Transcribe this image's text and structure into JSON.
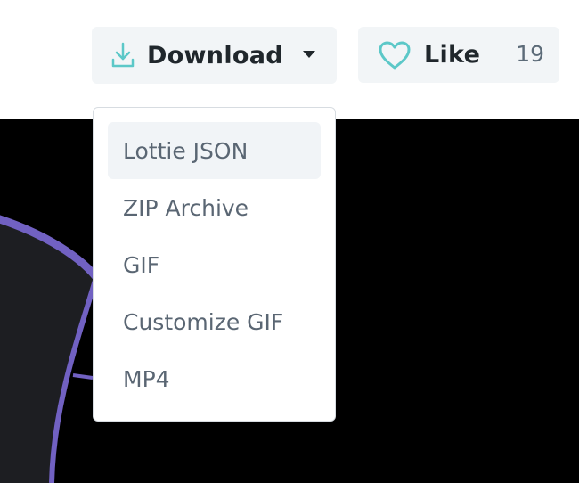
{
  "toolbar": {
    "download": {
      "label": "Download",
      "icon": "download-icon",
      "caret_icon": "caret-down-icon"
    },
    "like": {
      "label": "Like",
      "icon": "heart-icon",
      "count": "19"
    }
  },
  "download_menu": {
    "items": [
      {
        "label": "Lottie JSON",
        "active": true
      },
      {
        "label": "ZIP Archive",
        "active": false
      },
      {
        "label": "GIF",
        "active": false
      },
      {
        "label": "Customize GIF",
        "active": false
      },
      {
        "label": "MP4",
        "active": false
      }
    ]
  },
  "colors": {
    "accent_teal": "#5cc8c8",
    "preview_background": "#000000",
    "preview_shape_fill": "#1d1e22",
    "preview_shape_stroke": "#7161c2",
    "button_background": "#f2f5f7"
  }
}
